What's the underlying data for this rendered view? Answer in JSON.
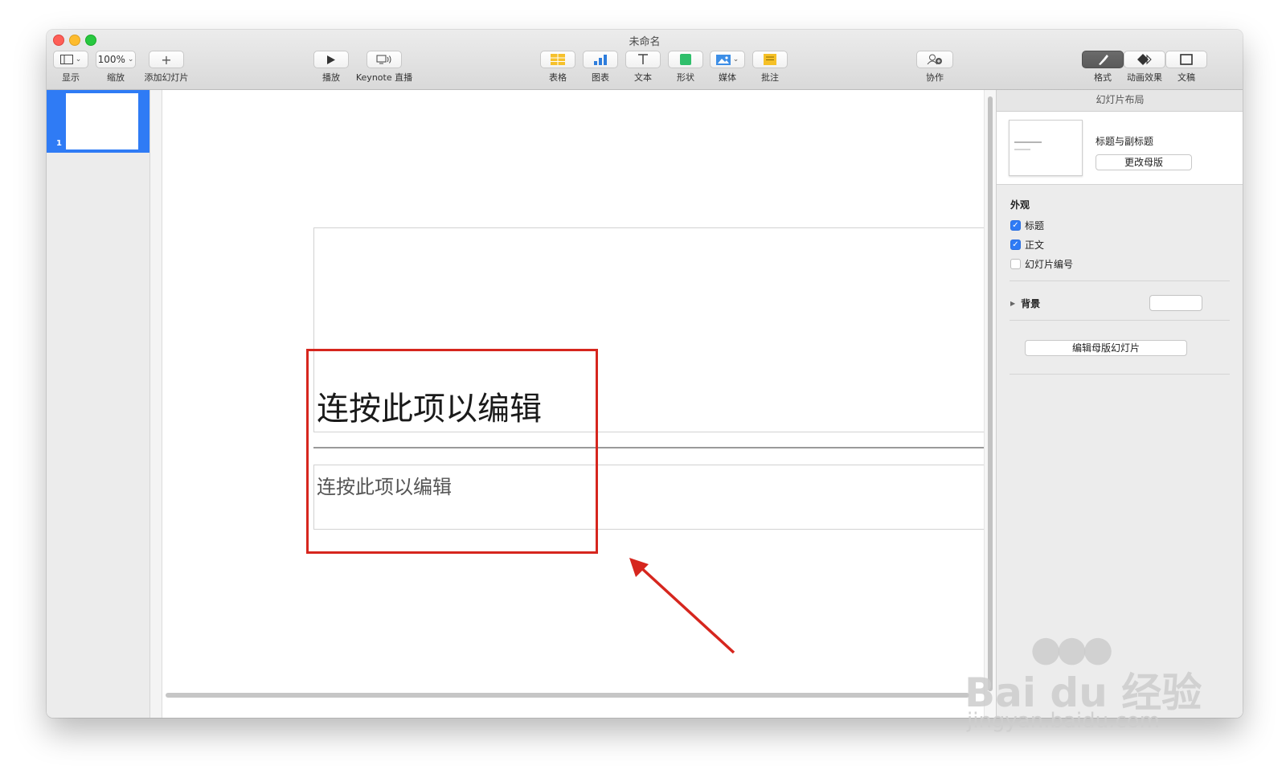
{
  "window": {
    "title": "未命名"
  },
  "toolbar": {
    "view_label": "显示",
    "zoom_value": "100%",
    "zoom_label": "缩放",
    "add_slide_label": "添加幻灯片",
    "play_label": "播放",
    "keynote_live_label": "Keynote 直播",
    "table_label": "表格",
    "chart_label": "图表",
    "text_label": "文本",
    "shape_label": "形状",
    "media_label": "媒体",
    "comment_label": "批注",
    "collaborate_label": "协作",
    "format_label": "格式",
    "animate_label": "动画效果",
    "document_label": "文稿"
  },
  "navigator": {
    "slides": [
      {
        "number": "1"
      }
    ]
  },
  "slide": {
    "title_placeholder": "连按此项以编辑",
    "subtitle_placeholder": "连按此项以编辑"
  },
  "inspector": {
    "header": "幻灯片布局",
    "layout_name": "标题与副标题",
    "change_master_label": "更改母版",
    "appearance_label": "外观",
    "checkboxes": [
      {
        "label": "标题",
        "checked": true
      },
      {
        "label": "正文",
        "checked": true
      },
      {
        "label": "幻灯片编号",
        "checked": false
      }
    ],
    "background_label": "背景",
    "background_color": "#ffffff",
    "edit_master_label": "编辑母版幻灯片"
  },
  "annotation": {
    "highlight_color": "#d6261e"
  },
  "watermark": {
    "brand": "Bai du 经验",
    "url": "jingyan.baidu.com"
  }
}
